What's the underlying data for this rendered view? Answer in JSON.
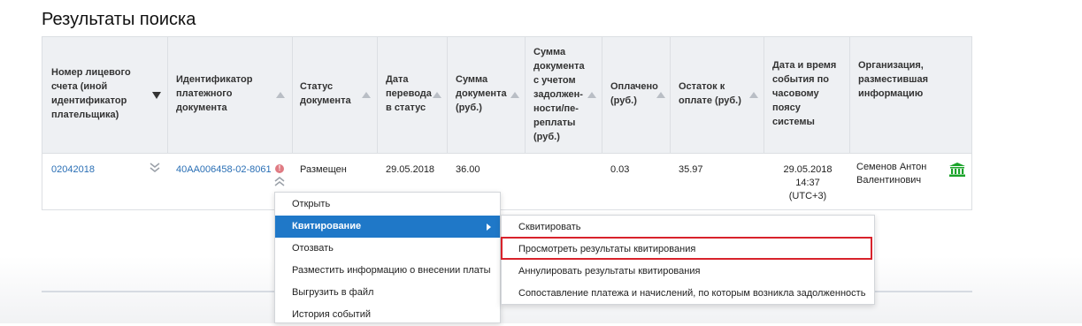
{
  "page": {
    "title": "Результаты поиска"
  },
  "table": {
    "headers": [
      {
        "label": "Номер лицевого счета (иной идентификатор плательщика)",
        "lines": [
          "Номер лицевого",
          "счета (иной",
          "идентификатор",
          "плательщика)"
        ],
        "sort": "desc-active"
      },
      {
        "lines": [
          "Идентификатор",
          "платежного",
          "документа"
        ],
        "sort": "asc"
      },
      {
        "lines": [
          "Статус",
          "документа"
        ],
        "sort": "asc"
      },
      {
        "lines": [
          "Дата",
          "перевода",
          "в статус"
        ],
        "sort": "asc"
      },
      {
        "lines": [
          "Сумма",
          "документа",
          "(руб.)"
        ],
        "sort": "asc"
      },
      {
        "lines": [
          "Сумма",
          "документа",
          "с учетом",
          "задолжен-",
          "ности/пе-",
          "реплаты",
          "(руб.)"
        ],
        "sort": "asc"
      },
      {
        "lines": [
          "Оплачено",
          "(руб.)"
        ],
        "sort": "asc"
      },
      {
        "lines": [
          "Остаток к",
          "оплате (руб.)"
        ],
        "sort": "asc"
      },
      {
        "lines": [
          "Дата и время",
          "события по",
          "часовому",
          "поясу",
          "системы"
        ],
        "sort": "none"
      },
      {
        "lines": [
          "Организация,",
          "разместившая",
          "информацию"
        ],
        "sort": "none"
      }
    ],
    "row": {
      "account": "02042018",
      "payment_id": "40AA006458-02-8061",
      "status": "Размещен",
      "status_date": "29.05.2018",
      "doc_sum": "36.00",
      "debt_sum": "",
      "paid": "0.03",
      "remaining": "35.97",
      "event_date": "29.05.2018",
      "event_time": "14:37",
      "event_tz": "(UTC+3)",
      "org_line1": "Семенов Антон",
      "org_line2": "Валентинович"
    }
  },
  "context_menu": {
    "items": [
      {
        "label": "Открыть"
      },
      {
        "label": "Квитирование",
        "active": true
      },
      {
        "label": "Отозвать"
      },
      {
        "label": "Разместить информацию о внесении платы"
      },
      {
        "label": "Выгрузить в файл"
      },
      {
        "label": "История событий"
      }
    ]
  },
  "submenu": {
    "items": [
      {
        "label": "Сквитировать"
      },
      {
        "label": "Просмотреть результаты квитирования",
        "highlighted": true
      },
      {
        "label": "Аннулировать результаты квитирования"
      },
      {
        "label": "Сопоставление платежа и начислений, по которым возникла задолженность"
      }
    ]
  },
  "colors": {
    "accent": "#1f78c8",
    "link": "#2a6fb5",
    "highlight": "#d8222b",
    "bank_icon": "#1aa32a"
  },
  "icons": [
    "sort-desc-icon",
    "sort-asc-icon",
    "expand-chevron-icon",
    "error-icon",
    "collapse-chevron-icon",
    "bank-icon",
    "submenu-arrow-icon"
  ]
}
